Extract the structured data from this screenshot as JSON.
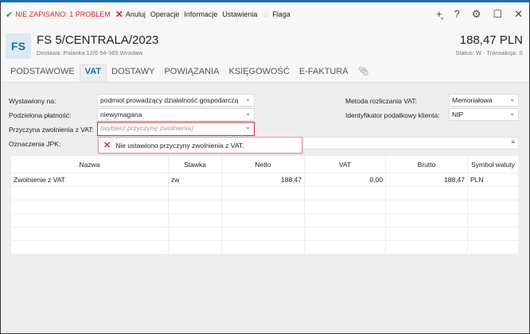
{
  "toolbar": {
    "status": "NIE ZAPISANO: 1 PROBLEM",
    "cancel": "Anuluj",
    "operations": "Operacje",
    "info": "Informacje",
    "settings": "Ustawienia",
    "flag": "Flaga"
  },
  "header": {
    "logo": "FS",
    "title": "FS 5/CENTRALA/2023",
    "delivery": "Dostawa: Polanka  12/6  54-365 Wrocław",
    "amount": "188,47 PLN",
    "status": "Status:  W  ·  Transakcja:  S"
  },
  "tabs": [
    "PODSTAWOWE",
    "VAT",
    "DOSTAWY",
    "POWIĄZANIA",
    "KSIĘGOWOŚĆ",
    "E-FAKTURA"
  ],
  "form": {
    "issued_label": "Wystawiony na:",
    "issued_value": "podmiot prowadzący działalność gospodarczą",
    "split_label": "Podzielona płatność:",
    "split_value": "niewymagana",
    "reason_label": "Przyczyna zwolnienia z VAT:",
    "reason_placeholder": "(wybierz przyczynę zwolnienia)",
    "jpk_label": "Oznaczenia JPK:",
    "method_label": "Metoda rozliczania VAT:",
    "method_value": "Memoriałowa",
    "taxid_label": "Identyfikator podatkowy klienta:",
    "taxid_value": "NIP",
    "error": "Nie ustawiono przyczyny zwolnienia z VAT."
  },
  "table": {
    "columns": [
      "Nazwa",
      "Stawka",
      "Netto",
      "VAT",
      "Brutto",
      "Symbol waluty"
    ],
    "rows": [
      [
        "Zwolnienie z VAT",
        "zw",
        "188,47",
        "0,00",
        "188,47",
        "PLN"
      ]
    ]
  },
  "colors": {
    "accent": "#1a6fb5",
    "error": "#d9262c",
    "ok": "#2e9b3a"
  }
}
